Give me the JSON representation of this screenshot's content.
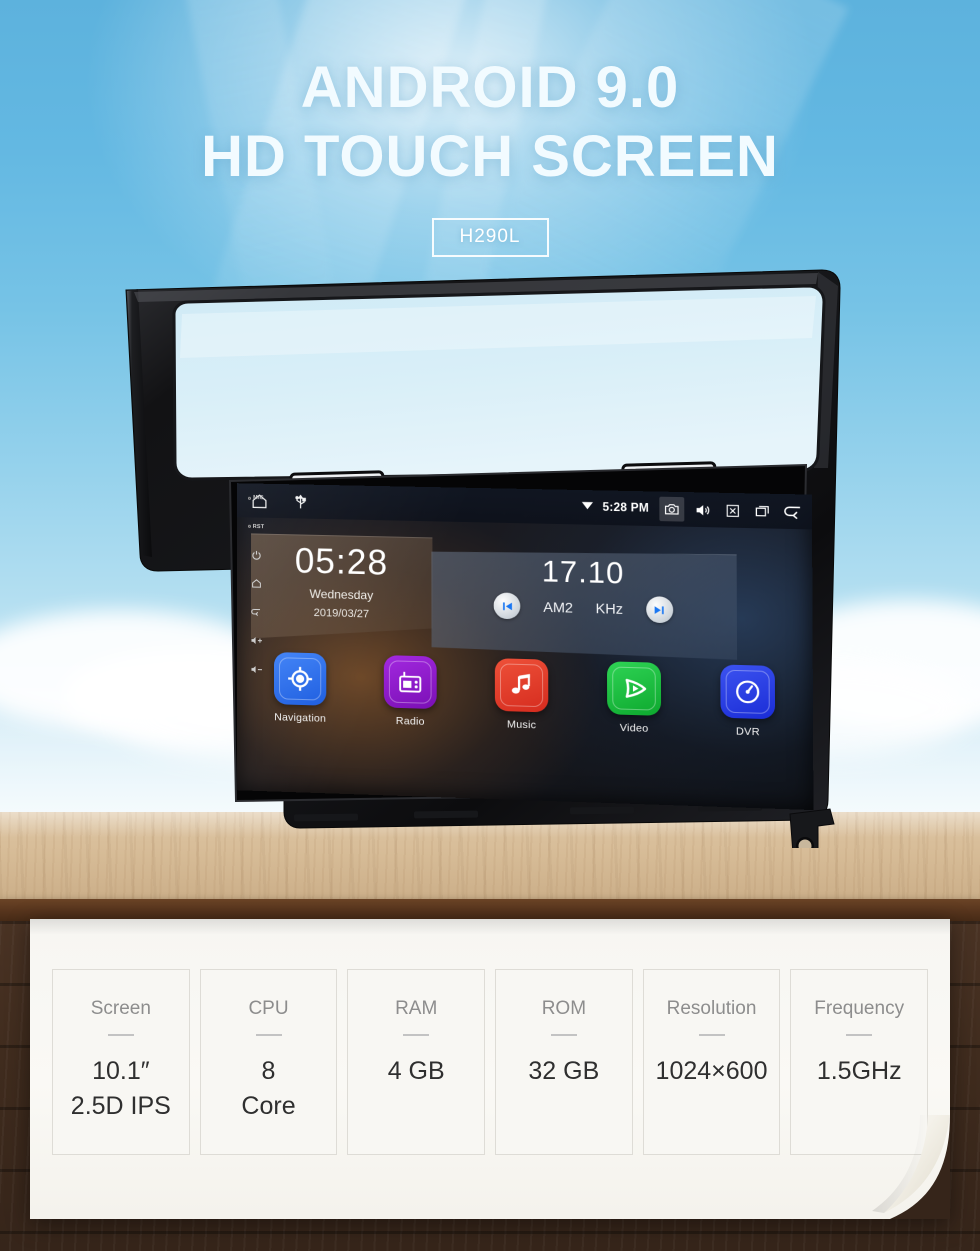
{
  "hero": {
    "line1": "ANDROID 9.0",
    "line2": "HD TOUCH SCREEN",
    "model_badge": "H290L"
  },
  "device": {
    "statusbar": {
      "home_icon": "home-icon",
      "usb_icon": "usb-icon",
      "wifi_icon": "wifi-icon",
      "time": "5:28 PM",
      "camera_icon": "camera-icon",
      "volume_icon": "volume-icon",
      "close_icon": "close-box-icon",
      "recents_icon": "recent-apps-icon",
      "back_icon": "back-arrow-icon"
    },
    "clock_widget": {
      "time": "05:28",
      "weekday": "Wednesday",
      "date": "2019/03/27"
    },
    "radio_widget": {
      "frequency": "17.10",
      "band": "AM2",
      "unit": "KHz",
      "prev_icon": "previous-track-icon",
      "next_icon": "next-track-icon"
    },
    "apps": [
      {
        "label": "Navigation",
        "icon": "navigation-target-icon",
        "color": "#2c6ef0"
      },
      {
        "label": "Radio",
        "icon": "radio-receiver-icon",
        "color": "#8f16c9"
      },
      {
        "label": "Music",
        "icon": "music-note-icon",
        "color": "#e33a28"
      },
      {
        "label": "Video",
        "icon": "video-play-icon",
        "color": "#16b93c"
      },
      {
        "label": "DVR",
        "icon": "dvr-gauge-icon",
        "color": "#2a3fe0"
      }
    ],
    "side_keys": [
      {
        "label": "MIC",
        "icon": "mic-pinhole-icon"
      },
      {
        "label": "RST",
        "icon": "reset-pinhole-icon"
      },
      {
        "label": "",
        "icon": "power-icon"
      },
      {
        "label": "",
        "icon": "home-key-icon"
      },
      {
        "label": "",
        "icon": "back-key-icon"
      },
      {
        "label": "",
        "icon": "volume-up-icon"
      },
      {
        "label": "",
        "icon": "volume-down-icon"
      }
    ]
  },
  "specs": [
    {
      "title": "Screen",
      "value_lines": [
        "10.1″",
        "2.5D IPS"
      ]
    },
    {
      "title": "CPU",
      "value_lines": [
        "8",
        "Core"
      ]
    },
    {
      "title": "RAM",
      "value_lines": [
        "4 GB"
      ]
    },
    {
      "title": "ROM",
      "value_lines": [
        "32 GB"
      ]
    },
    {
      "title": "Resolution",
      "value_lines": [
        "1024×600"
      ]
    },
    {
      "title": "Frequency",
      "value_lines": [
        "1.5GHz"
      ]
    }
  ],
  "colors": {
    "sky": "#5db2dd",
    "table": "#d6bb96",
    "floor": "#402c1e",
    "panel": "#f8f7f3",
    "accent_blue": "#2c6ef0"
  }
}
